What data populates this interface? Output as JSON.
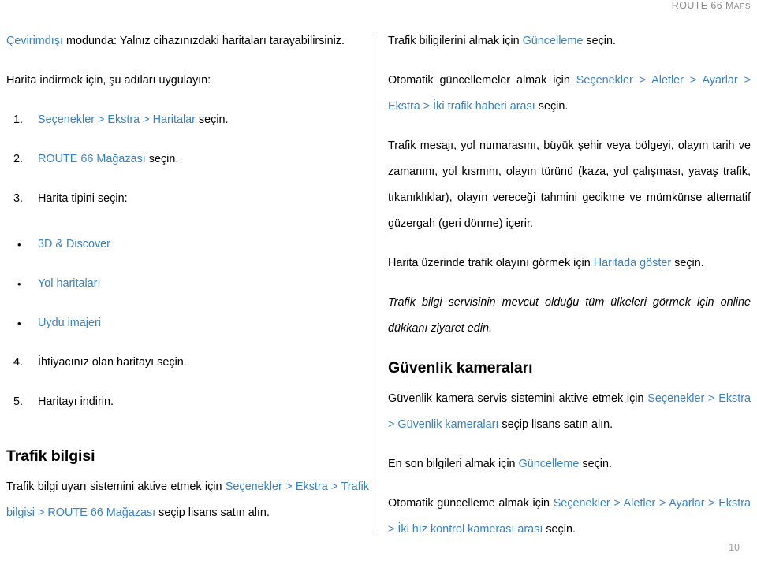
{
  "header": {
    "brand_main": "ROUTE 66 M",
    "brand_smallcaps": "APS"
  },
  "page_number": "10",
  "colors": {
    "link": "#3a80c1",
    "text": "#000000",
    "header_gray": "#8b8b8b",
    "divider": "#3c3c3c"
  },
  "left_column": {
    "intro_para": {
      "link_text": "Çevirimdışı",
      "rest": " modunda: Yalnız cihazınızdaki haritaları tarayabilirsiniz."
    },
    "steps_lead": "Harita indirmek için, şu adıları uygulayın:",
    "steps": [
      {
        "marker": "1.",
        "link_text": "Seçenekler > Ekstra > Haritalar",
        "rest": " seçin."
      },
      {
        "marker": "2.",
        "link_text": "ROUTE 66 Mağazası",
        "rest": " seçin."
      },
      {
        "marker": "3.",
        "link_text": "",
        "rest": "Harita tipini seçin:"
      }
    ],
    "map_types": [
      {
        "marker": "•",
        "label": "3D & Discover"
      },
      {
        "marker": "•",
        "label": "Yol haritaları"
      },
      {
        "marker": "•",
        "label": "Uydu imajeri"
      }
    ],
    "steps_cont": [
      {
        "marker": "4.",
        "rest": "İhtiyacınız olan haritayı seçin."
      },
      {
        "marker": "5.",
        "rest": "Haritayı indirin."
      }
    ],
    "traffic_heading": "Trafik bilgisi",
    "traffic_para": {
      "pre": "Trafik bilgi uyarı sistemini aktive etmek için ",
      "link_text": "Seçenekler > Ekstra > Trafik bilgisi > ROUTE 66 Mağazası",
      "post": " seçip lisans satın alın."
    }
  },
  "right_column": {
    "update_para": {
      "pre": "Trafik biligilerini almak için ",
      "link_text": "Güncelleme",
      "post": " seçin."
    },
    "auto_update_para": {
      "pre": "Otomatik güncellemeler almak için ",
      "link_text": "Seçenekler > Aletler > Ayarlar > Ekstra > İki trafik haberi arası",
      "post": " seçin."
    },
    "message_para": "Trafik mesajı, yol numarasını, büyük şehir veya bölgeyi, olayın tarih ve zamanını, yol kısmını, olayın türünü (kaza, yol çalışması, yavaş trafik, tıkanıklıklar), olayın vereceği tahmini gecikme ve mümkünse alternatif güzergah (geri dönme) içerir.",
    "show_on_map_para": {
      "pre": "Harita üzerinde trafik olayını görmek için ",
      "link_text": "Haritada göster",
      "post": " seçin."
    },
    "online_shop_para": "Trafik bilgi servisinin mevcut olduğu tüm ülkeleri görmek için online dükkanı ziyaret edin.",
    "cameras_heading": "Güvenlik kameraları",
    "cameras_activate_para": {
      "pre": "Güvenlik kamera servis sistemini aktive etmek için ",
      "link_text": "Seçenekler > Ekstra > Güvenlik kameraları",
      "post": " seçip lisans satın alın."
    },
    "cameras_update_para": {
      "pre": "En son bilgileri almak için ",
      "link_text": "Güncelleme",
      "post": " seçin."
    },
    "cameras_auto_para": {
      "pre": "Otomatik güncelleme almak için ",
      "link_text": "Seçenekler > Aletler > Ayarlar > Ekstra > İki hız kontrol kamerası arası",
      "post": " seçin."
    }
  }
}
